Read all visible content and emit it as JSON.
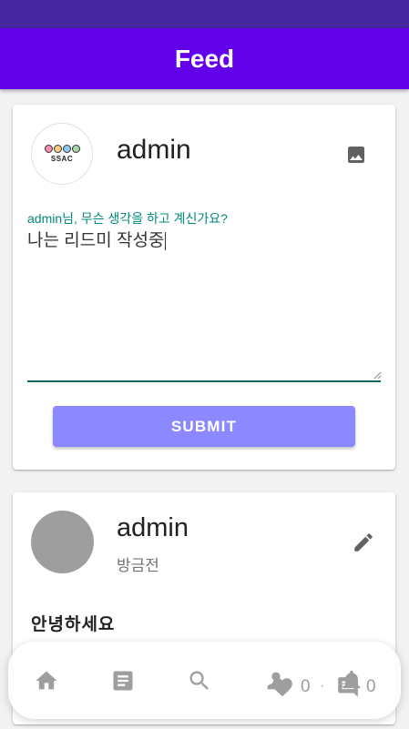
{
  "appbar": {
    "title": "Feed"
  },
  "compose": {
    "username": "admin",
    "logo_text": "SSAC",
    "prompt_label": "admin님, 무슨 생각을 하고 계신가요?",
    "input_value": "나는 리드미 작성중",
    "submit_label": "SUBMIT"
  },
  "post": {
    "username": "admin",
    "time": "방금전",
    "content": "안녕하세요",
    "likes": "0",
    "separator": "·",
    "comments": "0"
  },
  "icons": {
    "upload": "image-icon",
    "edit": "pencil-icon",
    "nav": [
      "home-icon",
      "article-icon",
      "search-icon",
      "person-icon",
      "bell-icon"
    ],
    "likes": "heart-icon",
    "comments": "comment-icon"
  },
  "colors": {
    "status_bar": "#4527a0",
    "app_bar": "#6200ea",
    "accent_teal": "#00897b",
    "submit_button": "#8c88ff"
  }
}
